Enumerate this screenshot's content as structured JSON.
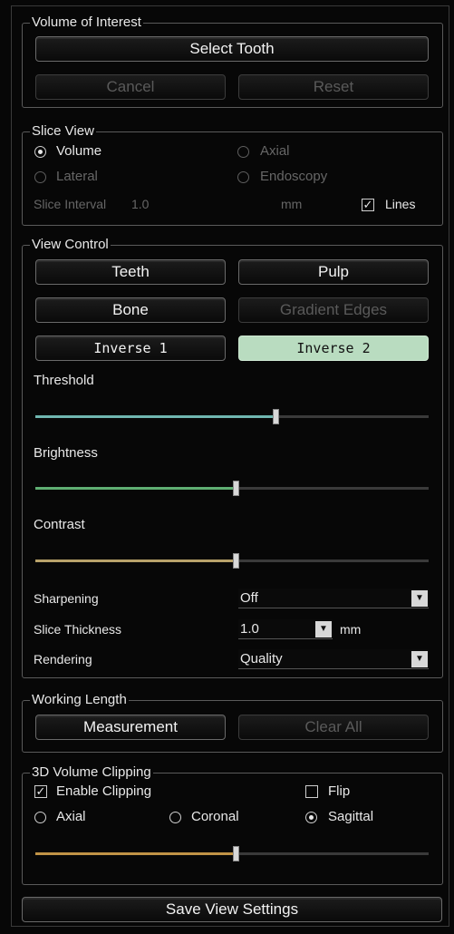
{
  "volume_of_interest": {
    "title": "Volume of Interest",
    "select_tooth": "Select Tooth",
    "cancel": "Cancel",
    "reset": "Reset"
  },
  "slice_view": {
    "title": "Slice View",
    "volume": "Volume",
    "axial": "Axial",
    "lateral": "Lateral",
    "endoscopy": "Endoscopy",
    "slice_interval_label": "Slice Interval",
    "slice_interval_value": "1.0",
    "slice_interval_unit": "mm",
    "lines_label": "Lines",
    "lines_checked": true
  },
  "view_control": {
    "title": "View Control",
    "teeth": "Teeth",
    "pulp": "Pulp",
    "bone": "Bone",
    "gradient_edges": "Gradient Edges",
    "inverse1": "Inverse 1",
    "inverse2": "Inverse 2",
    "threshold_label": "Threshold",
    "threshold_level": 0.61,
    "brightness_label": "Brightness",
    "brightness_level": 0.51,
    "contrast_label": "Contrast",
    "contrast_level": 0.51,
    "sharpening_label": "Sharpening",
    "sharpening_value": "Off",
    "slice_thickness_label": "Slice Thickness",
    "slice_thickness_value": "1.0",
    "slice_thickness_unit": "mm",
    "rendering_label": "Rendering",
    "rendering_value": "Quality",
    "colors": {
      "threshold": "#6fb6b0",
      "brightness": "#5fae72",
      "contrast": "#b8a26a"
    }
  },
  "working_length": {
    "title": "Working Length",
    "measurement": "Measurement",
    "clear_all": "Clear All"
  },
  "clipping": {
    "title": "3D Volume Clipping",
    "enable_label": "Enable Clipping",
    "flip_label": "Flip",
    "axial": "Axial",
    "coronal": "Coronal",
    "sagittal": "Sagittal",
    "clip_level": 0.51,
    "clip_color": "#c09346"
  },
  "save_view_settings": "Save View Settings"
}
